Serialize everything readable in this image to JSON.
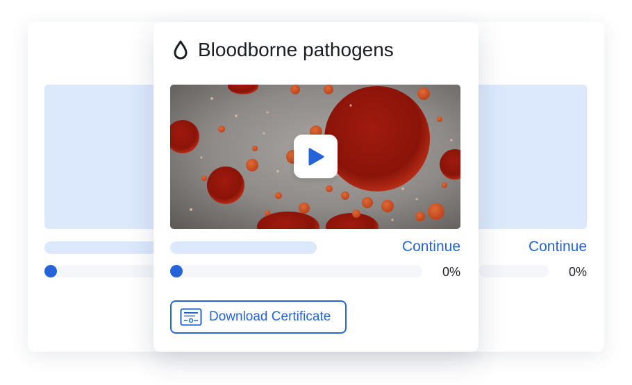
{
  "course": {
    "title": "Bloodborne pathogens",
    "icon": "droplet-icon",
    "continue_label": "Continue",
    "progress_text": "0%",
    "progress": 0,
    "certificate_label": "Download Certificate",
    "certificate_icon": "certificate-icon",
    "play_icon": "play-icon"
  },
  "right_card": {
    "continue_label": "Continue",
    "progress_text": "0%",
    "progress": 0
  },
  "colors": {
    "accent": "#2563d9",
    "placeholder": "#dce9fd",
    "track": "#f4f6fa"
  }
}
